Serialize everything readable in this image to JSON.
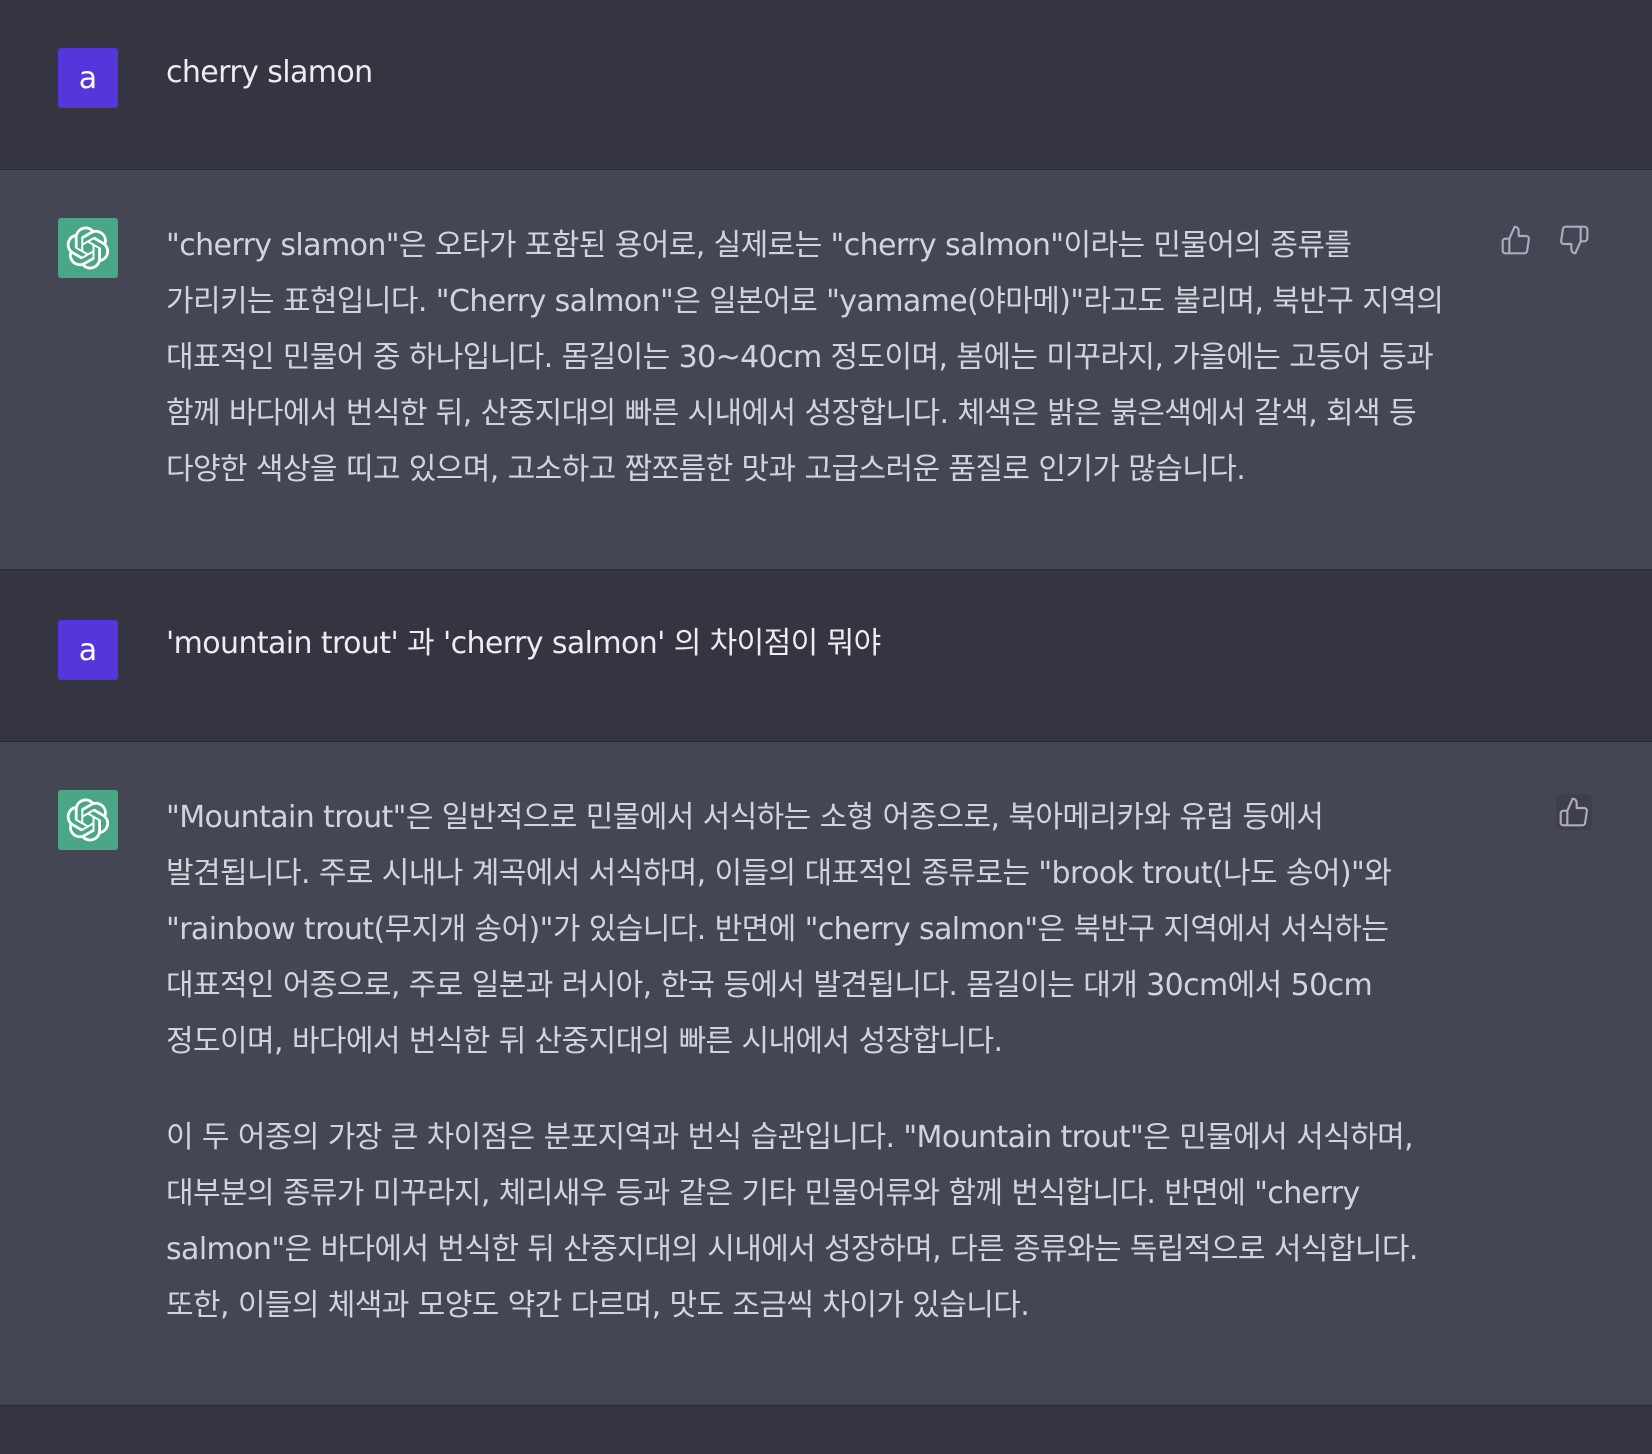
{
  "conversation": {
    "messages": [
      {
        "role": "user",
        "avatar_letter": "a",
        "paragraphs": [
          "cherry slamon"
        ]
      },
      {
        "role": "assistant",
        "paragraphs": [
          "\"cherry slamon\"은 오타가 포함된 용어로, 실제로는 \"cherry salmon\"이라는 민물어의 종류를 가리키는 표현입니다. \"Cherry salmon\"은 일본어로 \"yamame(야마메)\"라고도 불리며, 북반구 지역의 대표적인 민물어 중 하나입니다. 몸길이는 30~40cm 정도이며, 봄에는 미꾸라지, 가을에는 고등어 등과 함께 바다에서 번식한 뒤, 산중지대의 빠른 시내에서 성장합니다. 체색은 밝은 붉은색에서 갈색, 회색 등 다양한 색상을 띠고 있으며, 고소하고 짭쪼름한 맛과 고급스러운 품질로 인기가 많습니다."
        ],
        "actions": [
          "thumbs-up",
          "thumbs-down"
        ]
      },
      {
        "role": "user",
        "avatar_letter": "a",
        "paragraphs": [
          "'mountain trout' 과 'cherry salmon' 의 차이점이 뭐야"
        ]
      },
      {
        "role": "assistant",
        "paragraphs": [
          "\"Mountain trout\"은 일반적으로 민물에서 서식하는 소형 어종으로, 북아메리카와 유럽 등에서 발견됩니다. 주로 시내나 계곡에서 서식하며, 이들의 대표적인 종류로는 \"brook trout(나도 송어)\"와 \"rainbow trout(무지개 송어)\"가 있습니다. 반면에 \"cherry salmon\"은 북반구 지역에서 서식하는 대표적인 어종으로, 주로 일본과 러시아, 한국 등에서 발견됩니다. 몸길이는 대개 30cm에서 50cm 정도이며, 바다에서 번식한 뒤 산중지대의 빠른 시내에서 성장합니다.",
          "이 두 어종의 가장 큰 차이점은 분포지역과 번식 습관입니다. \"Mountain trout\"은 민물에서 서식하며, 대부분의 종류가 미꾸라지, 체리새우 등과 같은 기타 민물어류와 함께 번식합니다. 반면에 \"cherry salmon\"은 바다에서 번식한 뒤 산중지대의 시내에서 성장하며, 다른 종류와는 독립적으로 서식합니다. 또한, 이들의 체색과 모양도 약간 다르며, 맛도 조금씩 차이가 있습니다."
        ],
        "actions": [
          "thumbs-up"
        ]
      }
    ]
  },
  "colors": {
    "page_bg": "#343541",
    "assistant_bg": "#444654",
    "user_avatar": "#5436da",
    "bot_avatar": "#4aa785",
    "text": "#d1d5db"
  }
}
